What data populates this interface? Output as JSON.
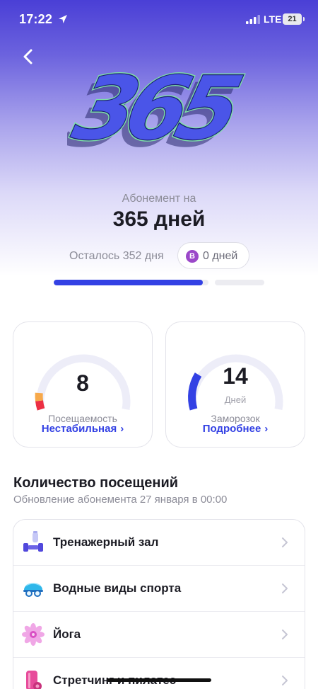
{
  "status_bar": {
    "time": "17:22",
    "network": "LTE",
    "battery": "21"
  },
  "hero": {
    "logo_text": "365",
    "subtitle": "Абонемент на",
    "title": "365 дней",
    "remaining": "Осталось 352 дня",
    "freeze_badge": "B",
    "freeze_days": "0 дней",
    "progress_fraction": 0.965,
    "colors": {
      "accent": "#3341e4",
      "logo_fill": "#4a55e8",
      "logo_outline": "#7ee0a8"
    }
  },
  "cards": {
    "attendance": {
      "value": "8",
      "label": "Посещаемость",
      "link": "Нестабильная"
    },
    "freeze": {
      "value": "14",
      "unit": "Дней",
      "label": "Заморозок",
      "link": "Подробнее"
    }
  },
  "visits": {
    "title": "Количество посещений",
    "subtitle": "Обновление абонемента 27 января в 00:00",
    "items": [
      {
        "label": "Тренажерный зал",
        "icon": "dumbbell-icon"
      },
      {
        "label": "Водные виды спорта",
        "icon": "swim-cap-icon"
      },
      {
        "label": "Йога",
        "icon": "lotus-icon"
      },
      {
        "label": "Стретчинг и пилатес",
        "icon": "yoga-mat-icon"
      }
    ]
  }
}
